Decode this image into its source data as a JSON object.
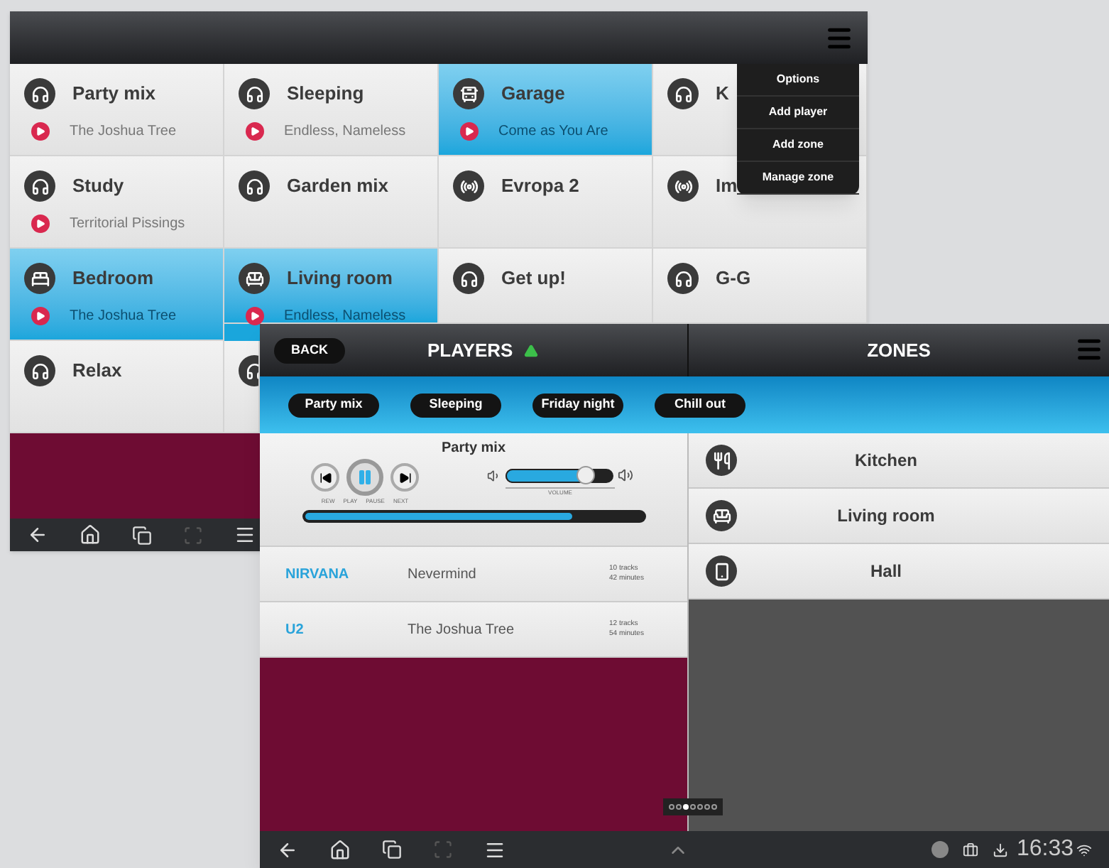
{
  "back_screen": {
    "tiles": [
      {
        "kind": "headphones",
        "label": "Party mix",
        "track": "The Joshua Tree",
        "selected": false
      },
      {
        "kind": "headphones",
        "label": "Sleeping",
        "track": "Endless, Nameless",
        "selected": false
      },
      {
        "kind": "bus",
        "label": "Garage",
        "track": "Come as You Are",
        "selected": true
      },
      {
        "kind": "headphones",
        "label": "K",
        "selected": false
      },
      {
        "kind": "headphones",
        "label": "Study",
        "track": "Territorial Pissings",
        "selected": false
      },
      {
        "kind": "headphones",
        "label": "Garden mix",
        "selected": false
      },
      {
        "kind": "radio",
        "label": "Evropa 2",
        "selected": false
      },
      {
        "kind": "radio",
        "label": "Im",
        "selected": false
      },
      {
        "kind": "bed",
        "label": "Bedroom",
        "track": "The Joshua Tree",
        "selected": true
      },
      {
        "kind": "sofa",
        "label": "Living room",
        "track": "Endless, Nameless",
        "selected": true
      },
      {
        "kind": "headphones",
        "label": "Get up!",
        "selected": false
      },
      {
        "kind": "headphones",
        "label": "G-G",
        "selected": false
      },
      {
        "kind": "headphones",
        "label": "Relax",
        "selected": false
      },
      {
        "kind": "headphones",
        "selected": false
      }
    ],
    "menu": [
      "Options",
      "Add player",
      "Add zone",
      "Manage zone"
    ]
  },
  "front_screen": {
    "back_button": "BACK",
    "players_title": "PLAYERS",
    "zones_title": "ZONES",
    "player_tabs": [
      "Party mix",
      "Sleeping",
      "Friday night",
      "Chill out"
    ],
    "player": {
      "title": "Party mix",
      "control_labels": [
        "REW",
        "PLAY",
        "PAUSE",
        "NEXT"
      ],
      "volume": {
        "label": "VOLUME",
        "level": 0.75
      },
      "progress": {
        "level": 0.79
      }
    },
    "albums": [
      {
        "artist": "NIRVANA",
        "album": "Nevermind",
        "tracks": "10 tracks",
        "duration": "42 minutes"
      },
      {
        "artist": "U2",
        "album": "The Joshua Tree",
        "tracks": "12 tracks",
        "duration": "54 minutes"
      }
    ],
    "zones": [
      {
        "kind": "utensils",
        "name": "Kitchen"
      },
      {
        "kind": "sofa",
        "name": "Living room"
      },
      {
        "kind": "phone",
        "name": "Hall"
      }
    ],
    "page_dots": [
      {
        "selected": false
      },
      {
        "selected": false
      },
      {
        "selected": true
      },
      {
        "selected": false
      },
      {
        "selected": false
      },
      {
        "selected": false
      },
      {
        "selected": false
      }
    ],
    "status_bar": {
      "time": "16:33"
    }
  }
}
